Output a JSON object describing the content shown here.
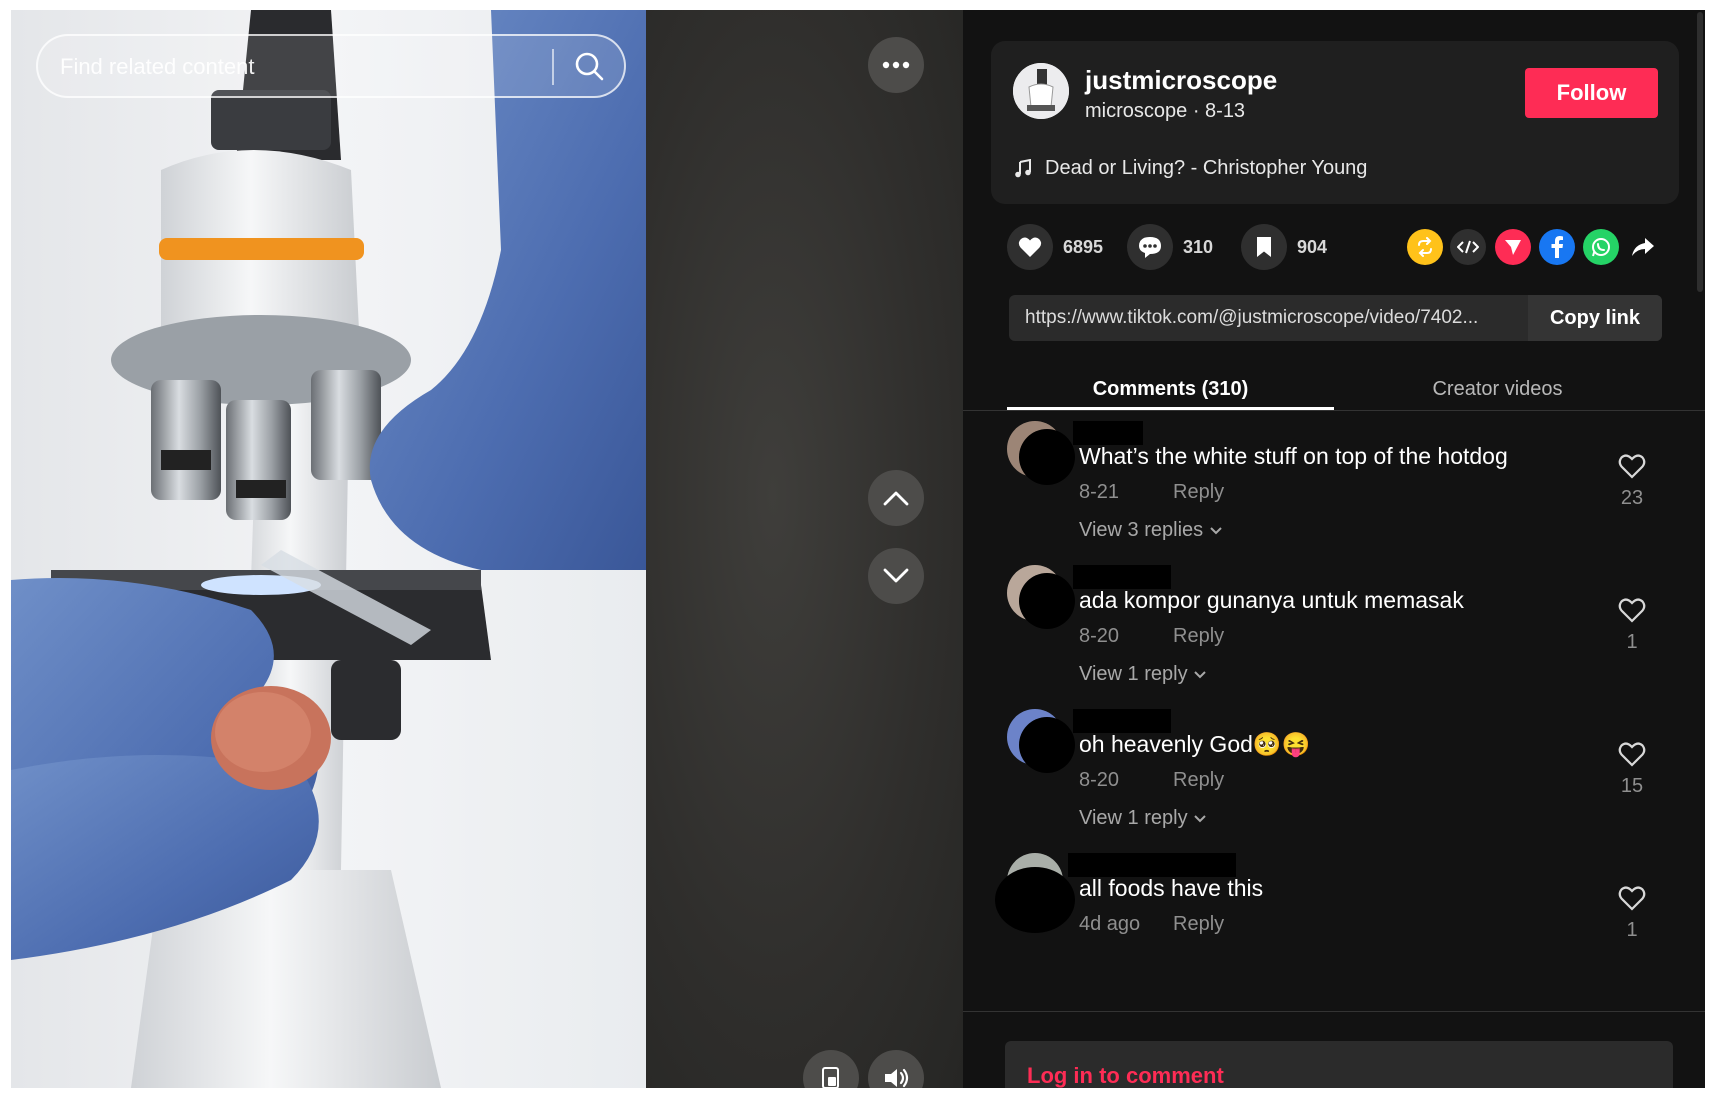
{
  "search": {
    "placeholder": "Find related content"
  },
  "author": {
    "username": "justmicroscope",
    "subline": "microscope · 8-13",
    "follow_label": "Follow",
    "music": "Dead or Living? - Christopher Young"
  },
  "stats": {
    "likes": "6895",
    "comments": "310",
    "saves": "904"
  },
  "share_icons": [
    "repost-icon",
    "embed-icon",
    "send-icon",
    "facebook-icon",
    "whatsapp-icon",
    "share-arrow-icon"
  ],
  "link": {
    "url": "https://www.tiktok.com/@justmicroscope/video/7402...",
    "copy_label": "Copy link"
  },
  "tabs": {
    "comments": "Comments (310)",
    "creator_videos": "Creator videos"
  },
  "comments": [
    {
      "text": "What’s the white stuff on top of the hotdog",
      "date": "8-21",
      "reply": "Reply",
      "view_replies": "View 3 replies",
      "likes": "23"
    },
    {
      "text": "ada kompor gunanya untuk memasak",
      "date": "8-20",
      "reply": "Reply",
      "view_replies": "View 1 reply",
      "likes": "1"
    },
    {
      "text": "oh heavenly God🥺😝",
      "date": "8-20",
      "reply": "Reply",
      "view_replies": "View 1 reply",
      "likes": "15"
    },
    {
      "text": "all foods have this",
      "date": "4d ago",
      "reply": "Reply",
      "view_replies": "",
      "likes": "1"
    }
  ],
  "login": {
    "label": "Log in to comment"
  },
  "colors": {
    "accent": "#fe2c55",
    "background": "#121212",
    "card": "#1f1f1f"
  }
}
